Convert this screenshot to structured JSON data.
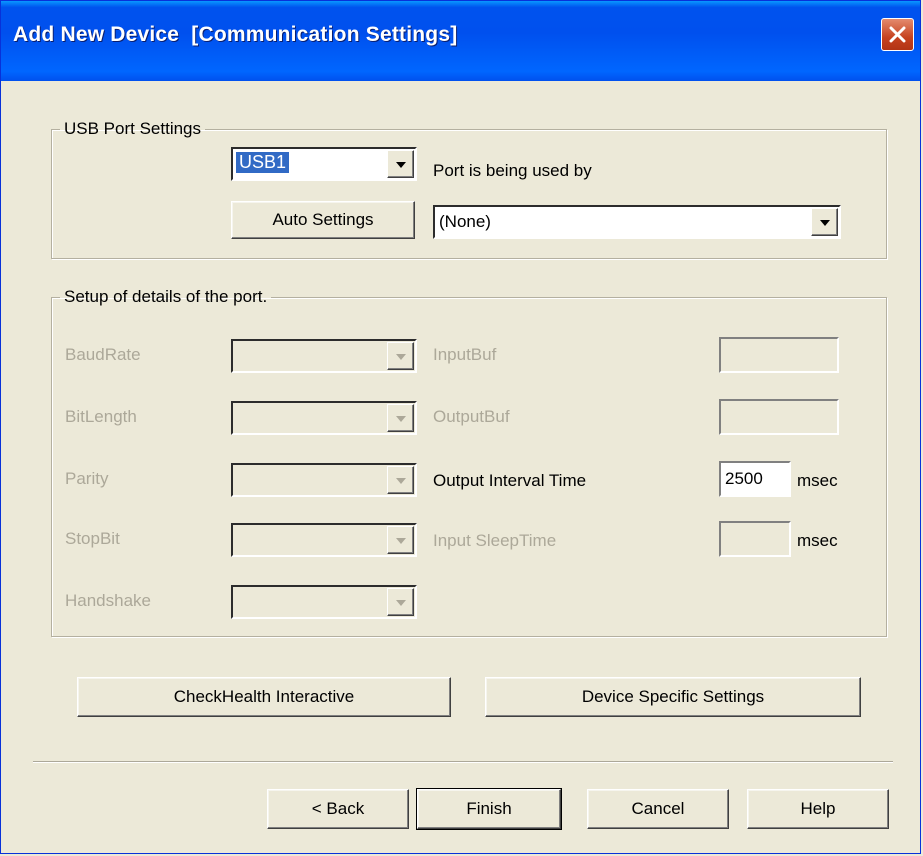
{
  "window": {
    "title": "Add New Device  [Communication Settings]"
  },
  "usb_group": {
    "legend": "USB Port Settings",
    "port_value": "USB1",
    "used_by_label": "Port is being used by",
    "auto_settings_label": "Auto Settings",
    "used_by_value": "(None)"
  },
  "details_group": {
    "legend": "Setup of details of the port.",
    "baud_rate_label": "BaudRate",
    "bit_length_label": "BitLength",
    "parity_label": "Parity",
    "stop_bit_label": "StopBit",
    "handshake_label": "Handshake",
    "input_buf_label": "InputBuf",
    "output_buf_label": "OutputBuf",
    "output_interval_label": "Output Interval Time",
    "output_interval_value": "2500",
    "output_interval_unit": "msec",
    "input_sleep_label": "Input SleepTime",
    "input_sleep_unit": "msec"
  },
  "actions": {
    "checkhealth_label": "CheckHealth Interactive",
    "device_specific_label": "Device Specific Settings"
  },
  "footer": {
    "back_label": "< Back",
    "finish_label": "Finish",
    "cancel_label": "Cancel",
    "help_label": "Help"
  },
  "colors": {
    "titlebar": "#0050ee",
    "face": "#ece9d8",
    "disabled_text": "#aca899",
    "selection": "#316ac5",
    "close": "#c6421f"
  }
}
